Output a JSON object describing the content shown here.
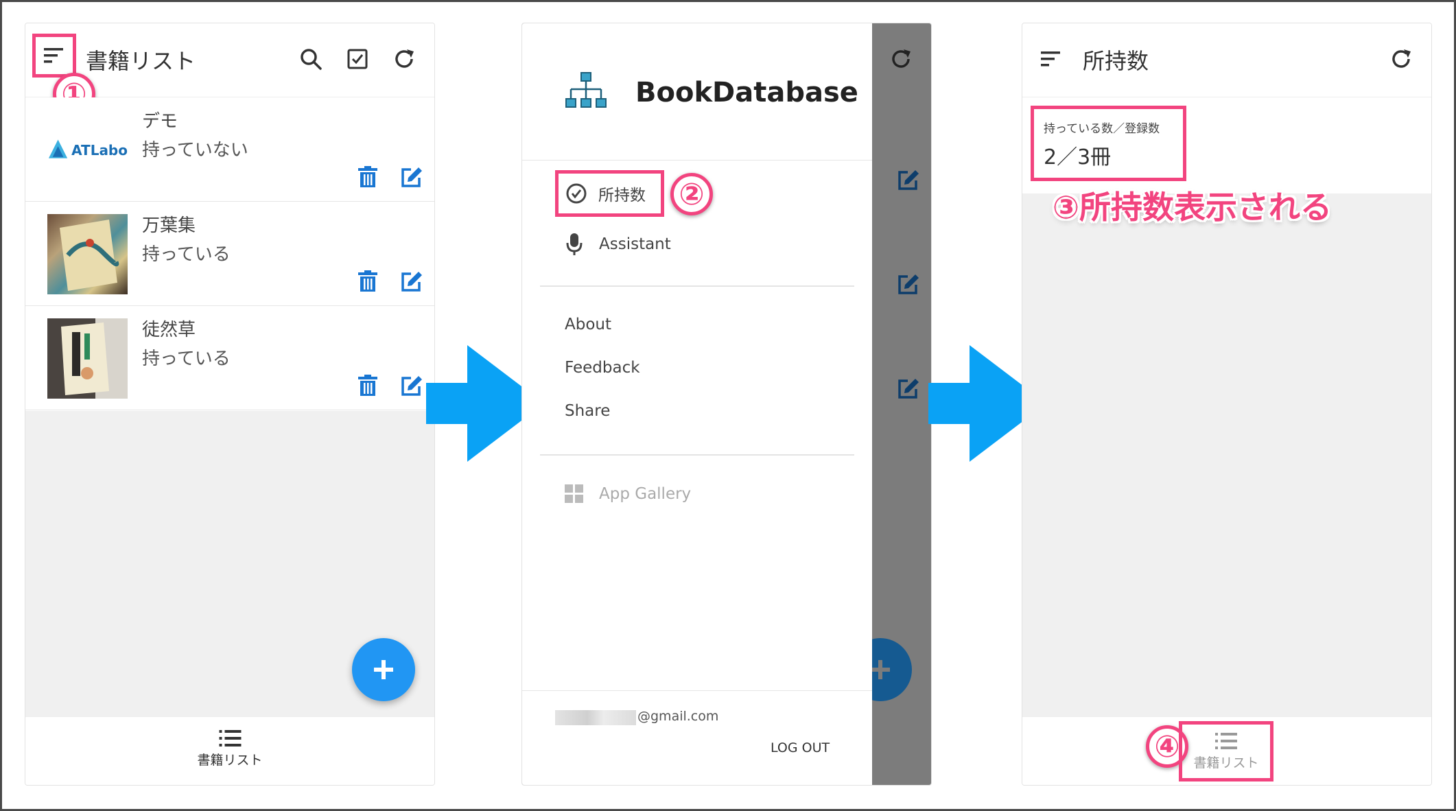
{
  "panel1": {
    "header_title": "書籍リスト",
    "books": [
      {
        "title": "デモ",
        "status": "持っていない",
        "thumb": "AT-Labo-logo",
        "logo_text": "ATLabo"
      },
      {
        "title": "万葉集",
        "status": "持っている",
        "thumb": "book-cover-photo"
      },
      {
        "title": "徒然草",
        "status": "持っている",
        "thumb": "book-cover-photo"
      }
    ],
    "bottom_nav_label": "書籍リスト",
    "callout": "①"
  },
  "panel2": {
    "app_name": "BookDatabase",
    "menu_primary": [
      {
        "label": "所持数",
        "icon": "check-circle-icon"
      },
      {
        "label": "Assistant",
        "icon": "microphone-icon"
      }
    ],
    "menu_secondary": [
      "About",
      "Feedback",
      "Share"
    ],
    "app_gallery": "App Gallery",
    "account_email_suffix": "@gmail.com",
    "logout_label": "LOG OUT",
    "callout": "②"
  },
  "panel3": {
    "header_title": "所持数",
    "card_label": "持っている数／登録数",
    "card_value": "2／3冊",
    "annotation": "③所持数表示される",
    "bottom_nav_label": "書籍リスト",
    "callout": "④"
  },
  "colors": {
    "accent_blue": "#1976d2",
    "arrow_blue": "#0aa2f5",
    "highlight_pink": "#f2447f",
    "fab_blue": "#2196f3"
  }
}
